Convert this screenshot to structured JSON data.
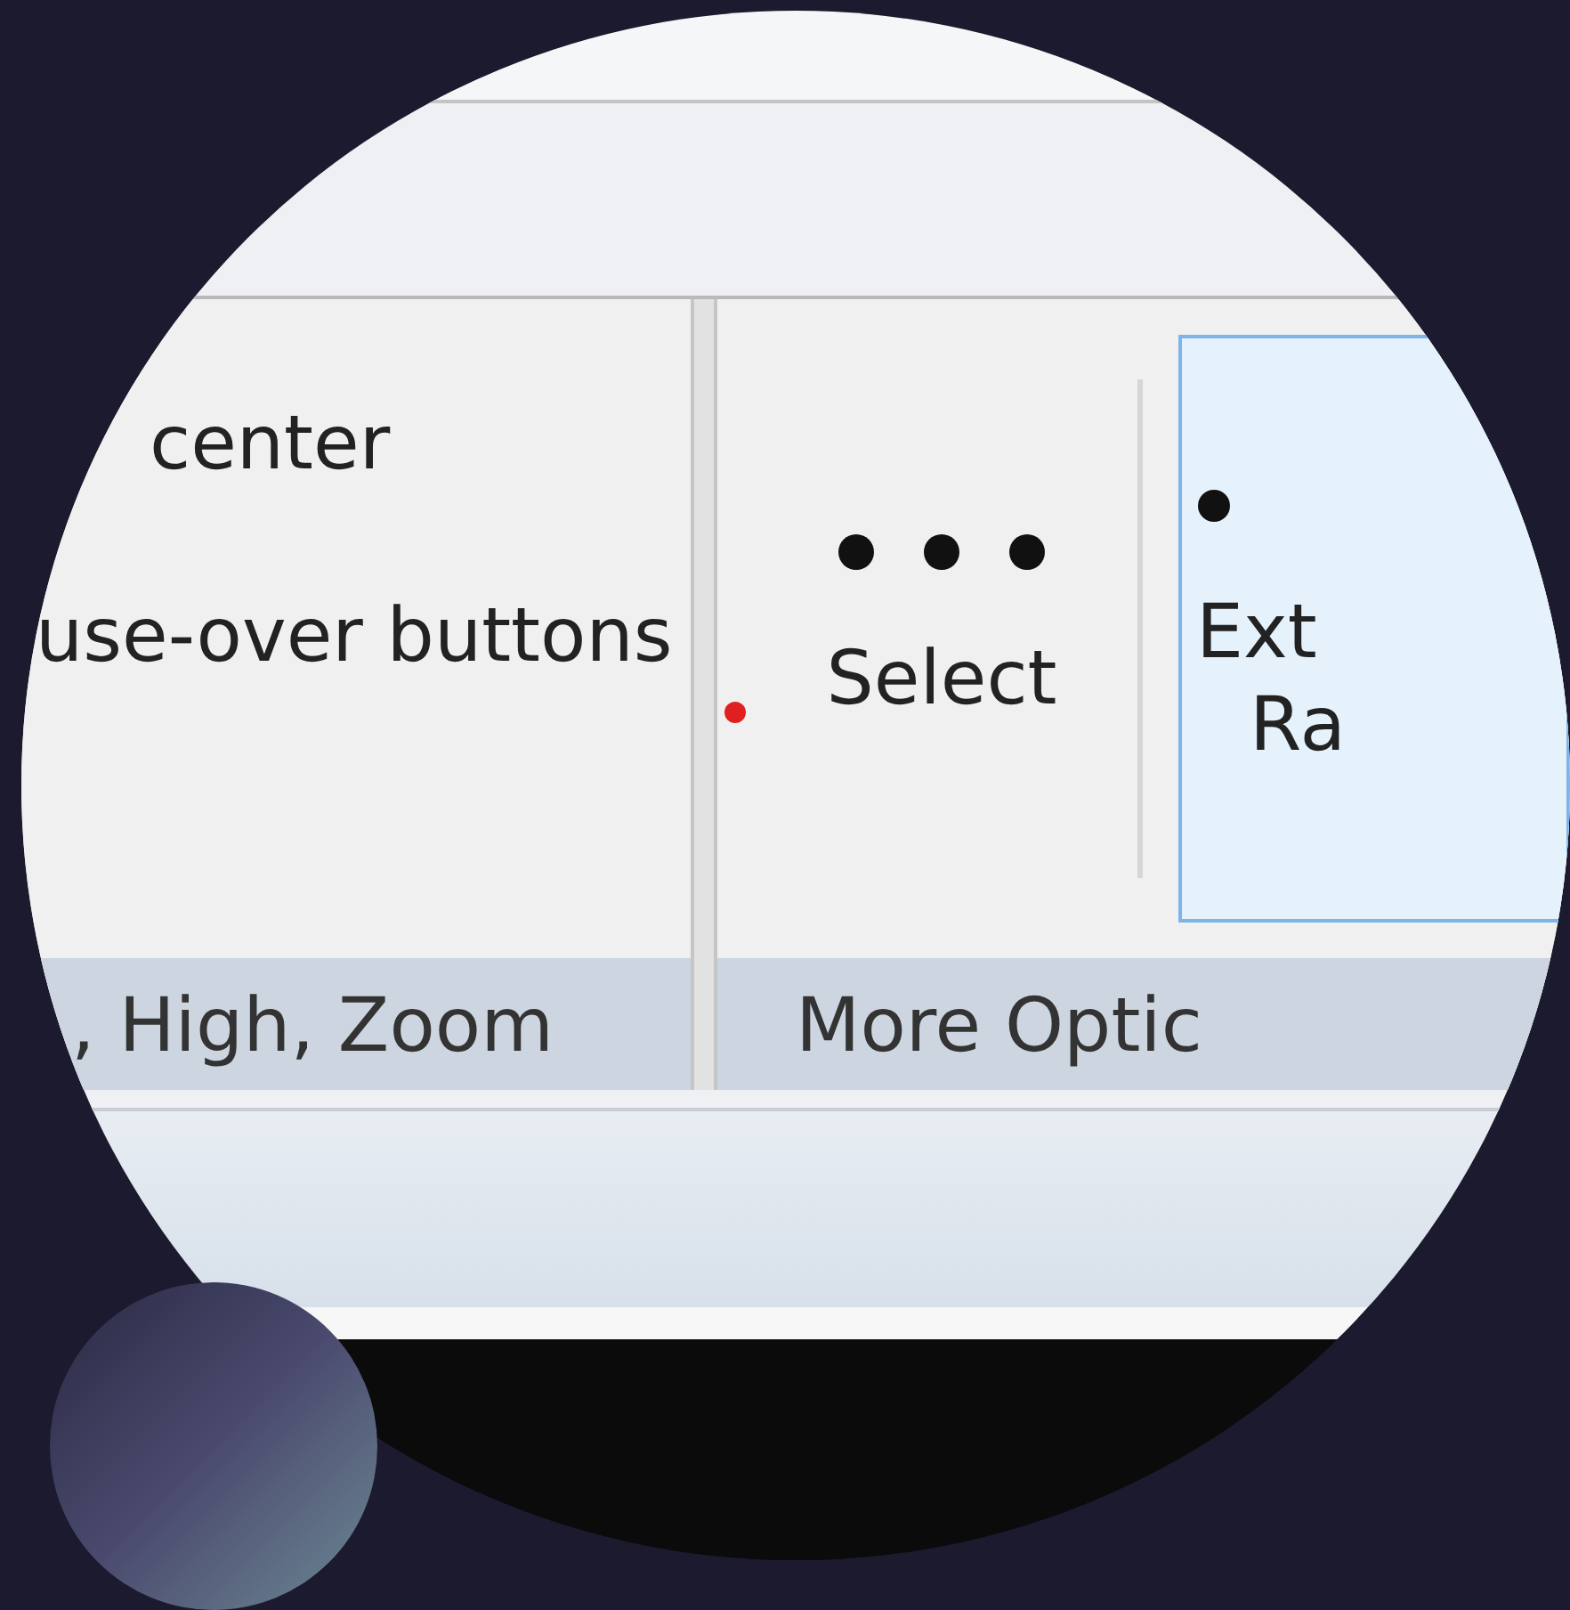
{
  "left_group": {
    "options": [
      "center",
      "use-over buttons"
    ],
    "label": ", High, Zoom"
  },
  "more_options_group": {
    "buttons": [
      {
        "label_lines": [
          "Select"
        ],
        "selected": false
      },
      {
        "label_lines": [
          "Ext",
          "Ra"
        ],
        "selected": true
      }
    ],
    "label": "More Optic"
  }
}
